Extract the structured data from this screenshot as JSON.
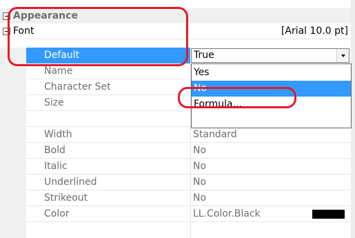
{
  "categories": {
    "appearance": "Appearance",
    "font": "Font"
  },
  "font_summary": "[Arial 10.0 pt]",
  "properties": {
    "default": {
      "name": "Default",
      "value": "True"
    },
    "name": {
      "name": "Name"
    },
    "charset": {
      "name": "Character Set"
    },
    "size": {
      "name": "Size"
    },
    "width": {
      "name": "Width",
      "value": "Standard"
    },
    "bold": {
      "name": "Bold",
      "value": "No"
    },
    "italic": {
      "name": "Italic",
      "value": "No"
    },
    "underlined": {
      "name": "Underlined",
      "value": "No"
    },
    "strikeout": {
      "name": "Strikeout",
      "value": "No"
    },
    "color": {
      "name": "Color",
      "value": "LL.Color.Black",
      "swatch": "#000000"
    }
  },
  "dropdown_options": [
    "Yes",
    "No",
    "Formula..."
  ],
  "highlighted_option": "No",
  "colors": {
    "selection": "#3399ff",
    "annotation": "#e01b2a"
  }
}
